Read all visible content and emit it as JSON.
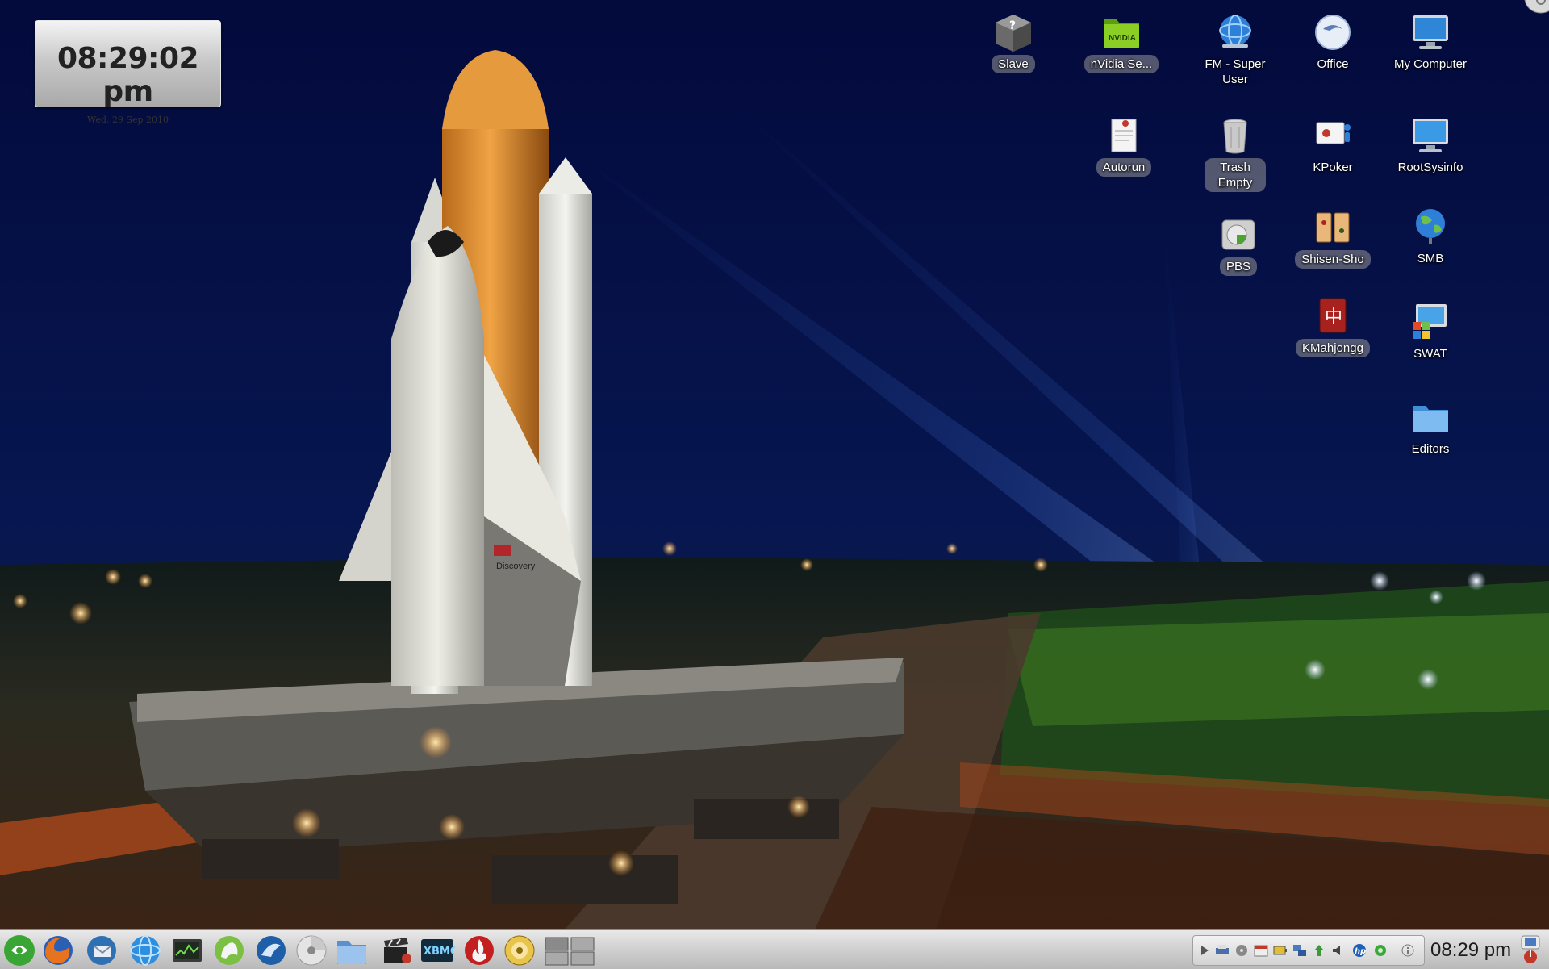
{
  "clock_widget": {
    "time": "08:29:02 pm",
    "date": "Wed, 29 Sep 2010"
  },
  "desktop_icons": [
    {
      "label": "Slave",
      "icon": "drive-unknown-icon"
    },
    {
      "label": "nVidia Se...",
      "icon": "nvidia-folder-icon"
    },
    {
      "label": "FM - Super User",
      "icon": "file-manager-globe-icon"
    },
    {
      "label": "Office",
      "icon": "office-icon"
    },
    {
      "label": "My Computer",
      "icon": "computer-icon"
    },
    {
      "label": "Autorun",
      "icon": "document-icon"
    },
    {
      "label": "Trash Empty",
      "icon": "trash-icon"
    },
    {
      "label": "KPoker",
      "icon": "kpoker-icon"
    },
    {
      "label": "RootSysinfo",
      "icon": "monitor-icon"
    },
    {
      "label": "PBS",
      "icon": "backup-drive-icon"
    },
    {
      "label": "Shisen-Sho",
      "icon": "shisen-sho-icon"
    },
    {
      "label": "SMB",
      "icon": "network-globe-icon"
    },
    {
      "label": "KMahjongg",
      "icon": "kmahjongg-icon"
    },
    {
      "label": "SWAT",
      "icon": "swat-icon"
    },
    {
      "label": "Editors",
      "icon": "folder-icon"
    }
  ],
  "taskbar": {
    "launchers": [
      "application-menu-icon",
      "firefox-icon",
      "thunderbird-icon",
      "network-globe-icon",
      "system-monitor-icon",
      "mandriva-control-center-icon",
      "file-manager-icon",
      "disc-burner-icon",
      "dolphin-folder-icon",
      "video-editor-icon",
      "xbmc-icon",
      "flame-icon",
      "media-player-icon",
      "pager-icon"
    ],
    "xbmc_text": "XBMC",
    "tray_icons": [
      "tray-arrow-icon",
      "tray-printer-icon",
      "tray-drive-icon",
      "tray-calendar-icon",
      "tray-battery-icon",
      "tray-network-icon",
      "tray-updates-icon",
      "tray-volume-icon",
      "tray-hp-icon",
      "tray-wifi-icon",
      "tray-info-icon"
    ],
    "clock": "08:29 pm"
  },
  "colors": {
    "sky": "#061045",
    "panel": "#cfcfcf",
    "accent": "#2e7fd8"
  }
}
